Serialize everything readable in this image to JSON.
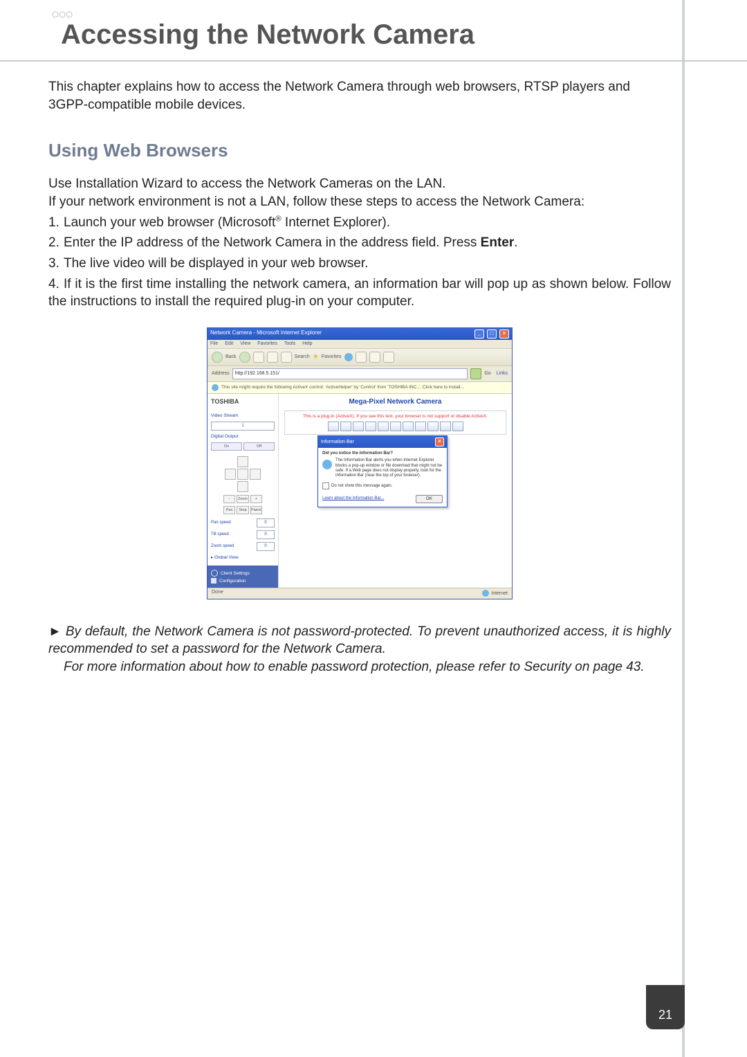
{
  "page_number": "21",
  "header_bubbles": "○○○",
  "chapter_title": "Accessing the Network Camera",
  "intro": "This chapter explains how to access the Network Camera through web browsers, RTSP players and 3GPP-compatible mobile devices.",
  "section_heading": "Using Web Browsers",
  "instr_lead1": "Use Installation Wizard to access the Network Cameras on the LAN.",
  "instr_lead2": "If your network environment is not a LAN, follow these steps to access the Network Camera:",
  "step1_num": "1.",
  "step1_a": "Launch your web browser (Microsoft",
  "step1_b": " Internet Explorer).",
  "step2_num": "2.",
  "step2_a": "Enter the IP address of the Network Camera in the address field. Press ",
  "step2_enter": "Enter",
  "step2_b": ".",
  "step3_num": "3.",
  "step3": "The live video will be displayed in your web browser.",
  "step4_num": "4.",
  "step4a": "If it is the first time installing the network camera, an information bar will pop up as shown below. Follow the instructions to install the required plug-in on your computer.",
  "note_arrow": "►",
  "note1": "By default, the Network Camera is not password-protected. To prevent unauthorized access, it is highly recommended to set a password for the Network Camera.",
  "note2": "For more information about how to enable password protection, please refer to Security on page 43.",
  "ie": {
    "title": "Network Camera - Microsoft Internet Explorer",
    "menu": {
      "file": "File",
      "edit": "Edit",
      "view": "View",
      "favorites": "Favorites",
      "tools": "Tools",
      "help": "Help"
    },
    "toolbar": {
      "back": "Back",
      "search": "Search",
      "favorites": "Favorites"
    },
    "address_label": "Address",
    "address_url": "http://192.168.5.151/",
    "go": "Go",
    "links": "Links",
    "infobar": "This site might require the following ActiveX control: 'ActiveHelper' by 'Control' from 'TOSHIBA INC.,'. Click here to install...",
    "brand": "TOSHIBA",
    "video_stream_label": "Video Stream",
    "video_stream_value": "1",
    "digital_output_label": "Digital Output",
    "do_on": "On",
    "do_off": "Off",
    "zoom_out": "-",
    "zoom_label": "Zoom",
    "zoom_in": "+",
    "pan": "Pan",
    "stop": "Stop",
    "patrol": "Patrol",
    "pan_speed": "Pan speed",
    "tilt_speed": "Tilt speed",
    "zoom_speed": "Zoom speed",
    "speed_value": "0",
    "global_view": "▸ Global View",
    "client_settings": "Client Settings",
    "configuration": "Configuration",
    "cam_title": "Mega-Pixel Network Camera",
    "plugin_msg": "This is a plug-in (ActiveX). If you see this text, your browser is not support or disable ActiveX.",
    "popup_title": "Information Bar",
    "popup_q": "Did you notice the Information Bar?",
    "popup_body": "The Information Bar alerts you when Internet Explorer blocks a pop-up window or file download that might not be safe. If a Web page does not display properly, look for the Information Bar (near the top of your browser).",
    "popup_chk": "Do not show this message again.",
    "popup_link": "Learn about the Information Bar...",
    "popup_ok": "OK",
    "status_done": "Done",
    "status_zone": "Internet"
  }
}
